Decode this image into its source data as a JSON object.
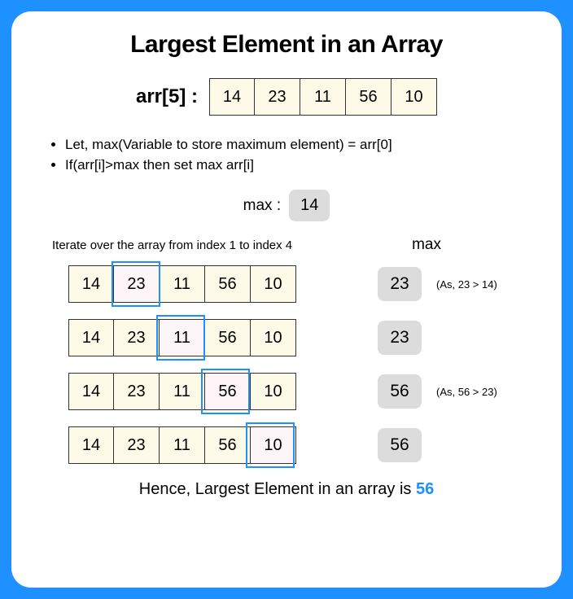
{
  "title": "Largest Element in an Array",
  "array_label": "arr[5] :",
  "array_values": [
    "14",
    "23",
    "11",
    "56",
    "10"
  ],
  "bullets": [
    "Let, max(Variable to store maximum element) = arr[0]",
    "If(arr[i]>max then set max arr[i]"
  ],
  "initial_max_label": "max :",
  "initial_max_value": "14",
  "iterate_text": "Iterate over the array from index 1 to index 4",
  "max_column_header": "max",
  "steps": [
    {
      "highlight_index": 1,
      "max": "23",
      "note": "(As, 23 > 14)"
    },
    {
      "highlight_index": 2,
      "max": "23",
      "note": ""
    },
    {
      "highlight_index": 3,
      "max": "56",
      "note": "(As, 56 > 23)"
    },
    {
      "highlight_index": 4,
      "max": "56",
      "note": ""
    }
  ],
  "conclusion_prefix": "Hence, Largest Element in an array is ",
  "conclusion_answer": "56"
}
